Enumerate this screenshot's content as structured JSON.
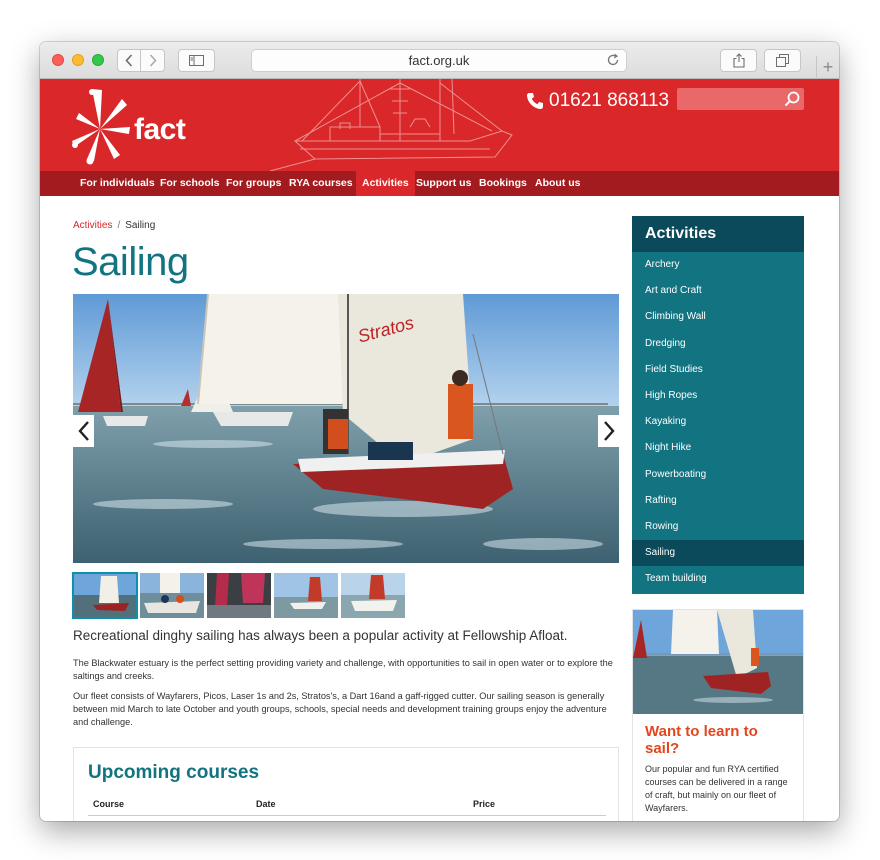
{
  "browser": {
    "url": "fact.org.uk"
  },
  "header": {
    "logo_text": "fact",
    "phone": "01621 868113",
    "search_placeholder": ""
  },
  "nav": [
    {
      "label": "For individuals"
    },
    {
      "label": "For schools"
    },
    {
      "label": "For groups"
    },
    {
      "label": "RYA courses"
    },
    {
      "label": "Activities"
    },
    {
      "label": "Support us"
    },
    {
      "label": "Bookings"
    },
    {
      "label": "About us"
    }
  ],
  "breadcrumb": {
    "parent": "Activities",
    "separator": "/",
    "current": "Sailing"
  },
  "page": {
    "title": "Sailing",
    "lead": "Recreational dinghy sailing has always been a popular activity at Fellowship Afloat.",
    "paragraph_1": "The Blackwater estuary is the perfect setting providing variety and challenge, with opportunities to sail in open water or to explore the saltings and creeks.",
    "paragraph_2": "Our fleet consists of Wayfarers, Picos, Laser 1s and 2s, Stratos's, a Dart 16and a gaff-rigged cutter. Our sailing season is generally between mid March to late October and youth groups, schools, special needs and development training groups enjoy the adventure and challenge."
  },
  "courses": {
    "title": "Upcoming courses",
    "columns": [
      "Course",
      "Date",
      "Price"
    ]
  },
  "sidebar": {
    "title": "Activities",
    "items": [
      {
        "label": "Archery"
      },
      {
        "label": "Art and Craft"
      },
      {
        "label": "Climbing Wall"
      },
      {
        "label": "Dredging"
      },
      {
        "label": "Field Studies"
      },
      {
        "label": "High Ropes"
      },
      {
        "label": "Kayaking"
      },
      {
        "label": "Night Hike"
      },
      {
        "label": "Powerboating"
      },
      {
        "label": "Rafting"
      },
      {
        "label": "Rowing"
      },
      {
        "label": "Sailing"
      },
      {
        "label": "Team building"
      }
    ],
    "active_item": "Sailing"
  },
  "promo": {
    "title": "Want to learn to sail?",
    "text": "Our popular and fun RYA certified courses can be delivered in a range of craft, but mainly on our fleet of Wayfarers."
  },
  "colors": {
    "brand_red": "#da2729",
    "nav_dark_red": "#a21b1e",
    "teal": "#127381",
    "teal_dark": "#0a4a5a",
    "promo_orange": "#e3461e"
  },
  "icons": [
    "back-chevron-icon",
    "forward-chevron-icon",
    "sidebar-icon",
    "reload-icon",
    "share-icon",
    "tabs-icon",
    "phone-icon",
    "search-icon",
    "slider-prev-icon",
    "slider-next-icon"
  ]
}
